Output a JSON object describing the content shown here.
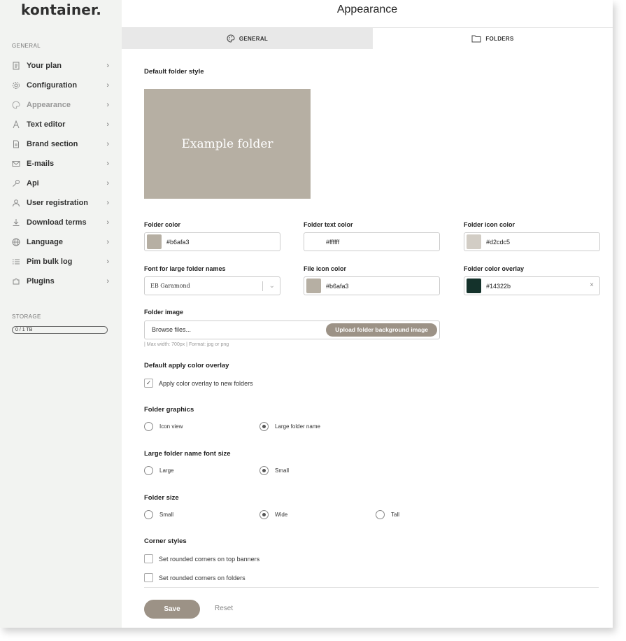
{
  "sidebar": {
    "logo": "kontainer.",
    "general_label": "GENERAL",
    "items": [
      {
        "label": "Your plan",
        "icon": "document-icon"
      },
      {
        "label": "Configuration",
        "icon": "gear-icon"
      },
      {
        "label": "Appearance",
        "icon": "palette-icon"
      },
      {
        "label": "Text editor",
        "icon": "text-icon"
      },
      {
        "label": "Brand section",
        "icon": "file-icon"
      },
      {
        "label": "E-mails",
        "icon": "mail-icon"
      },
      {
        "label": "Api",
        "icon": "key-icon"
      },
      {
        "label": "User registration",
        "icon": "user-icon"
      },
      {
        "label": "Download terms",
        "icon": "download-icon"
      },
      {
        "label": "Language",
        "icon": "globe-icon"
      },
      {
        "label": "Pim bulk log",
        "icon": "list-icon"
      },
      {
        "label": "Plugins",
        "icon": "plugin-icon"
      }
    ],
    "chevron": "›",
    "storage_label": "STORAGE",
    "storage_value": "0 / 1 TB"
  },
  "header": {
    "title": "Appearance"
  },
  "tabs": {
    "general": "GENERAL",
    "folders": "FOLDERS"
  },
  "form": {
    "default_folder_style": "Default folder style",
    "preview_text": "Example folder",
    "folder_color_label": "Folder color",
    "folder_color_value": "#b6afa3",
    "folder_text_color_label": "Folder text color",
    "folder_text_color_value": "#ffffff",
    "folder_icon_color_label": "Folder icon color",
    "folder_icon_color_value": "#d2cdc5",
    "font_large_label": "Font for large folder names",
    "font_large_value": "EB Garamond",
    "file_icon_color_label": "File icon color",
    "file_icon_color_value": "#b6afa3",
    "overlay_label": "Folder color overlay",
    "overlay_value": "#14322b",
    "overlay_clear": "×",
    "folder_image_label": "Folder image",
    "browse_text": "Browse files...",
    "upload_button": "Upload folder background image",
    "image_hint": "| Max width: 700px | Format: jpg or png",
    "apply_overlay_heading": "Default apply color overlay",
    "apply_overlay_checkbox": "Apply color overlay to new folders",
    "folder_graphics_heading": "Folder graphics",
    "graphics_icon_view": "Icon view",
    "graphics_large_name": "Large folder name",
    "font_size_heading": "Large folder name font size",
    "font_size_large": "Large",
    "font_size_small": "Small",
    "folder_size_heading": "Folder size",
    "size_small": "Small",
    "size_wide": "Wide",
    "size_tall": "Tall",
    "corner_heading": "Corner styles",
    "corner_banners": "Set rounded corners on top banners",
    "corner_folders": "Set rounded corners on folders",
    "save": "Save",
    "reset": "Reset"
  },
  "colors": {
    "folder": "#b6afa3",
    "text": "#ffffff",
    "icon": "#d2cdc5",
    "overlay": "#14322b",
    "accent_button": "#9c9286"
  }
}
